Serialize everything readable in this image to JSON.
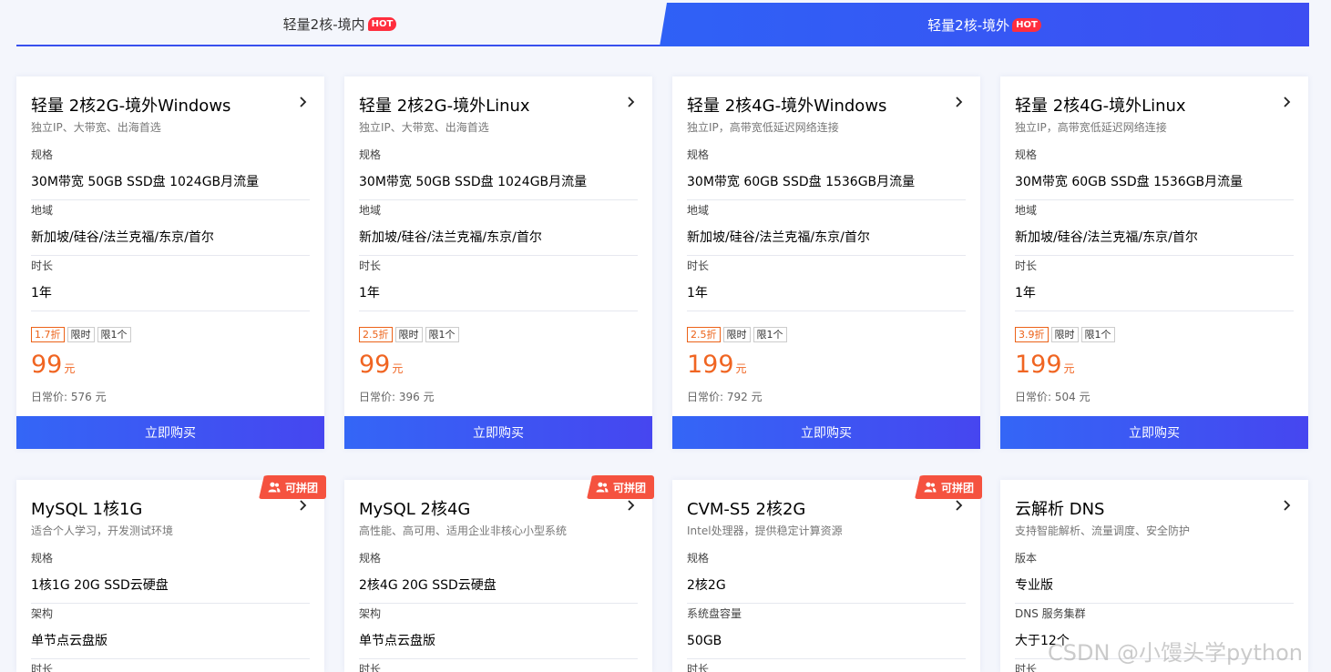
{
  "tabs": [
    {
      "label": "轻量2核-境内",
      "badge": "HOT",
      "active": false
    },
    {
      "label": "轻量2核-境外",
      "badge": "HOT",
      "active": true
    }
  ],
  "cards_row1": [
    {
      "title": "轻量 2核2G-境外Windows",
      "subtitle": "独立IP、大带宽、出海首选",
      "specs": [
        {
          "label": "规格",
          "value": "30M带宽 50GB SSD盘 1024GB月流量"
        },
        {
          "label": "地域",
          "value": "新加坡/硅谷/法兰克福/东京/首尔"
        },
        {
          "label": "时长",
          "value": "1年"
        }
      ],
      "tags": [
        "1.7折",
        "限时",
        "限1个"
      ],
      "price": "99",
      "price_unit": "元",
      "original_price": "日常价: 576 元",
      "buy_label": "立即购买"
    },
    {
      "title": "轻量 2核2G-境外Linux",
      "subtitle": "独立IP、大带宽、出海首选",
      "specs": [
        {
          "label": "规格",
          "value": "30M带宽 50GB SSD盘 1024GB月流量"
        },
        {
          "label": "地域",
          "value": "新加坡/硅谷/法兰克福/东京/首尔"
        },
        {
          "label": "时长",
          "value": "1年"
        }
      ],
      "tags": [
        "2.5折",
        "限时",
        "限1个"
      ],
      "price": "99",
      "price_unit": "元",
      "original_price": "日常价: 396 元",
      "buy_label": "立即购买"
    },
    {
      "title": "轻量 2核4G-境外Windows",
      "subtitle": "独立IP，高带宽低延迟网络连接",
      "specs": [
        {
          "label": "规格",
          "value": "30M带宽 60GB SSD盘 1536GB月流量"
        },
        {
          "label": "地域",
          "value": "新加坡/硅谷/法兰克福/东京/首尔"
        },
        {
          "label": "时长",
          "value": "1年"
        }
      ],
      "tags": [
        "2.5折",
        "限时",
        "限1个"
      ],
      "price": "199",
      "price_unit": "元",
      "original_price": "日常价: 792 元",
      "buy_label": "立即购买"
    },
    {
      "title": "轻量 2核4G-境外Linux",
      "subtitle": "独立IP，高带宽低延迟网络连接",
      "specs": [
        {
          "label": "规格",
          "value": "30M带宽 60GB SSD盘 1536GB月流量"
        },
        {
          "label": "地域",
          "value": "新加坡/硅谷/法兰克福/东京/首尔"
        },
        {
          "label": "时长",
          "value": "1年"
        }
      ],
      "tags": [
        "3.9折",
        "限时",
        "限1个"
      ],
      "price": "199",
      "price_unit": "元",
      "original_price": "日常价: 504 元",
      "buy_label": "立即购买"
    }
  ],
  "cards_row2": [
    {
      "title": "MySQL 1核1G",
      "subtitle": "适合个人学习，开发测试环境",
      "badge": "可拼团",
      "specs": [
        {
          "label": "规格",
          "value": "1核1G 20G SSD云硬盘"
        },
        {
          "label": "架构",
          "value": "单节点云盘版"
        },
        {
          "label": "时长",
          "value": ""
        }
      ]
    },
    {
      "title": "MySQL 2核4G",
      "subtitle": "高性能、高可用、适用企业非核心小型系统",
      "badge": "可拼团",
      "specs": [
        {
          "label": "规格",
          "value": "2核4G 20G SSD云硬盘"
        },
        {
          "label": "架构",
          "value": "单节点云盘版"
        },
        {
          "label": "时长",
          "value": ""
        }
      ]
    },
    {
      "title": "CVM-S5 2核2G",
      "subtitle": "Intel处理器，提供稳定计算资源",
      "badge": "可拼团",
      "specs": [
        {
          "label": "规格",
          "value": "2核2G"
        },
        {
          "label": "系统盘容量",
          "value": "50GB"
        },
        {
          "label": "时长",
          "value": ""
        }
      ]
    },
    {
      "title": "云解析 DNS",
      "subtitle": "支持智能解析、流量调度、安全防护",
      "badge": "",
      "specs": [
        {
          "label": "版本",
          "value": "专业版"
        },
        {
          "label": "DNS 服务集群",
          "value": "大于12个"
        },
        {
          "label": "时长",
          "value": ""
        }
      ]
    }
  ],
  "watermark": "CSDN @小馒头学python",
  "colors": {
    "accent": "#3d55f3",
    "price": "#f06522",
    "hot": "#ff2e3e",
    "group": "#f5523f"
  }
}
